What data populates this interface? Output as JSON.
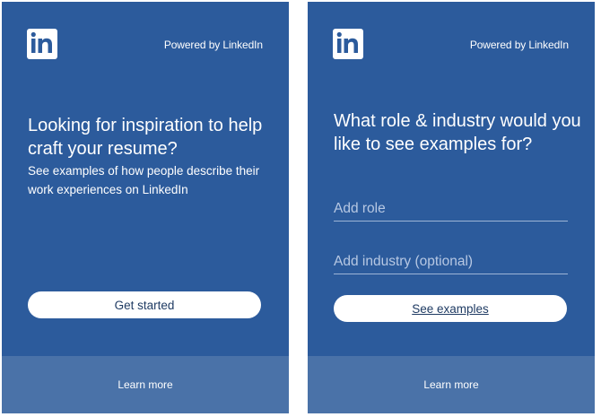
{
  "branding": {
    "powered_by": "Powered by LinkedIn",
    "logo_icon": "linkedin-logo-icon"
  },
  "intro_panel": {
    "headline": "Looking for inspiration to help craft your resume?",
    "subtext": "See examples of how people describe their work experiences on LinkedIn",
    "cta_label": "Get started",
    "footer_link": "Learn more"
  },
  "search_panel": {
    "headline": "What role & industry would you like to see examples for?",
    "role_field": {
      "value": "",
      "placeholder": "Add role"
    },
    "industry_field": {
      "value": "",
      "placeholder": "Add industry (optional)"
    },
    "cta_label": "See examples",
    "footer_link": "Learn more"
  },
  "colors": {
    "panel_bg": "#2c5b9c",
    "footer_bg": "#4a72a8",
    "button_bg": "#ffffff",
    "button_text": "#1f3b63"
  }
}
